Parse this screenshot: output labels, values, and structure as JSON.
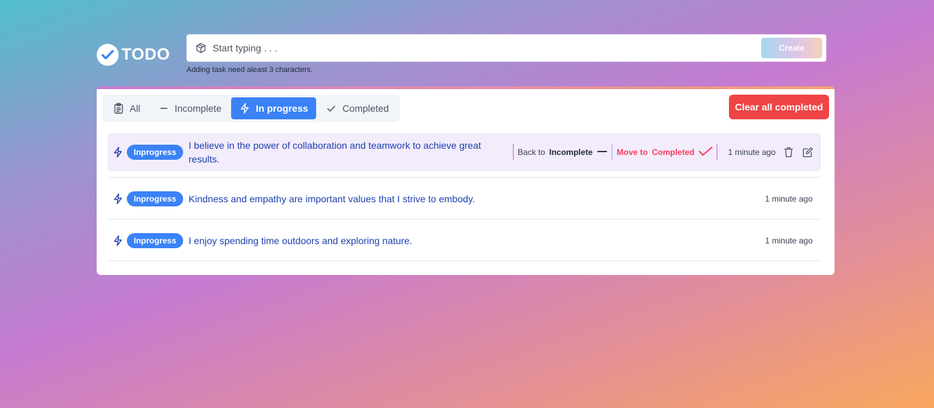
{
  "app": {
    "title": "TODO"
  },
  "create": {
    "placeholder": "Start typing . . .",
    "button_label": "Create",
    "hint": "Adding task need aleast 3 characters."
  },
  "filters": [
    {
      "label": "All",
      "icon": "clipboard-icon",
      "active": false
    },
    {
      "label": "Incomplete",
      "icon": "minus-icon",
      "active": false
    },
    {
      "label": "In progress",
      "icon": "bolt-icon",
      "active": true
    },
    {
      "label": "Completed",
      "icon": "check-icon",
      "active": false
    }
  ],
  "clear_button_label": "Clear all completed",
  "tasks": [
    {
      "status": "Inprogress",
      "text": "I believe in the power of collaboration and teamwork to achieve great results.",
      "time": "1 minute ago",
      "actions": {
        "back_prefix": "Back to",
        "back_target": "Incomplete",
        "move_prefix": "Move to",
        "move_target": "Completed"
      }
    },
    {
      "status": "Inprogress",
      "text": "Kindness and empathy are important values that I strive to embody.",
      "time": "1 minute ago"
    },
    {
      "status": "Inprogress",
      "text": "I enjoy spending time outdoors and exploring nature.",
      "time": "1 minute ago"
    }
  ],
  "colors": {
    "accent": "#3b82f6",
    "danger": "#ef4444",
    "task_text": "#1e40af",
    "move_action": "#f43f5e"
  }
}
